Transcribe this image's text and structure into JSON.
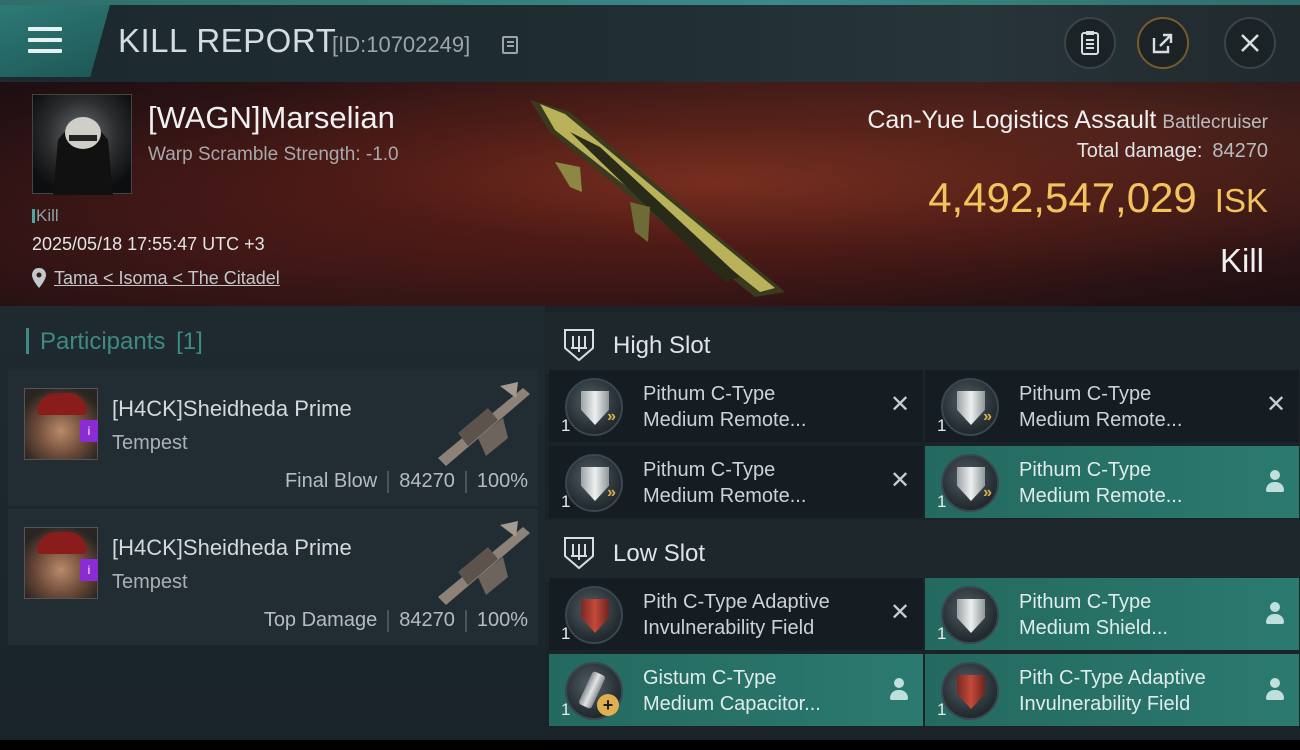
{
  "header": {
    "title": "KILL REPORT",
    "report_id": "[ID:10702249]"
  },
  "victim": {
    "pilot": "[WAGN]Marselian",
    "warp_scramble": "Warp Scramble Strength: -1.0",
    "result_small": "Kill",
    "datetime": "2025/05/18 17:55:47 UTC +3",
    "location": "Tama < Isoma < The Citadel",
    "ship_name": "Can-Yue Logistics Assault",
    "ship_class": "Battlecruiser",
    "total_damage_label": "Total damage:",
    "total_damage": "84270",
    "isk_value": "4,492,547,029",
    "isk_unit": "ISK",
    "result": "Kill"
  },
  "participants": {
    "heading": "Participants",
    "count": "[1]",
    "items": [
      {
        "name": "[H4CK]Sheidheda Prime",
        "ship": "Tempest",
        "role": "Final Blow",
        "damage": "84270",
        "percent": "100%"
      },
      {
        "name": "[H4CK]Sheidheda Prime",
        "ship": "Tempest",
        "role": "Top Damage",
        "damage": "84270",
        "percent": "100%"
      }
    ]
  },
  "slots": {
    "high": {
      "title": "High Slot",
      "modules": [
        {
          "line1": "Pithum C-Type",
          "line2": "Medium Remote...",
          "qty": "1",
          "action": "destroyed"
        },
        {
          "line1": "Pithum C-Type",
          "line2": "Medium Remote...",
          "qty": "1",
          "action": "destroyed"
        },
        {
          "line1": "Pithum C-Type",
          "line2": "Medium Remote...",
          "qty": "1",
          "action": "destroyed"
        },
        {
          "line1": "Pithum C-Type",
          "line2": "Medium Remote...",
          "qty": "1",
          "action": "dropped"
        }
      ]
    },
    "low": {
      "title": "Low Slot",
      "modules": [
        {
          "line1": "Pith C-Type Adaptive",
          "line2": "Invulnerability Field",
          "qty": "1",
          "action": "destroyed"
        },
        {
          "line1": "Pithum C-Type",
          "line2": "Medium Shield...",
          "qty": "1",
          "action": "dropped"
        },
        {
          "line1": "Gistum C-Type",
          "line2": "Medium Capacitor...",
          "qty": "1",
          "action": "dropped"
        },
        {
          "line1": "Pith C-Type Adaptive",
          "line2": "Invulnerability Field",
          "qty": "1",
          "action": "dropped"
        }
      ]
    }
  },
  "icons": {
    "menu": "menu-icon",
    "copy": "copy-icon",
    "clipboard": "clipboard-icon",
    "share": "share-icon",
    "close": "close-icon",
    "location": "location-pin-icon",
    "destroyed": "x-mark-icon",
    "dropped": "person-icon"
  },
  "colors": {
    "accent": "#3f8a84",
    "isk": "#f3c35c",
    "dropped_bg": "#2b7a70"
  }
}
